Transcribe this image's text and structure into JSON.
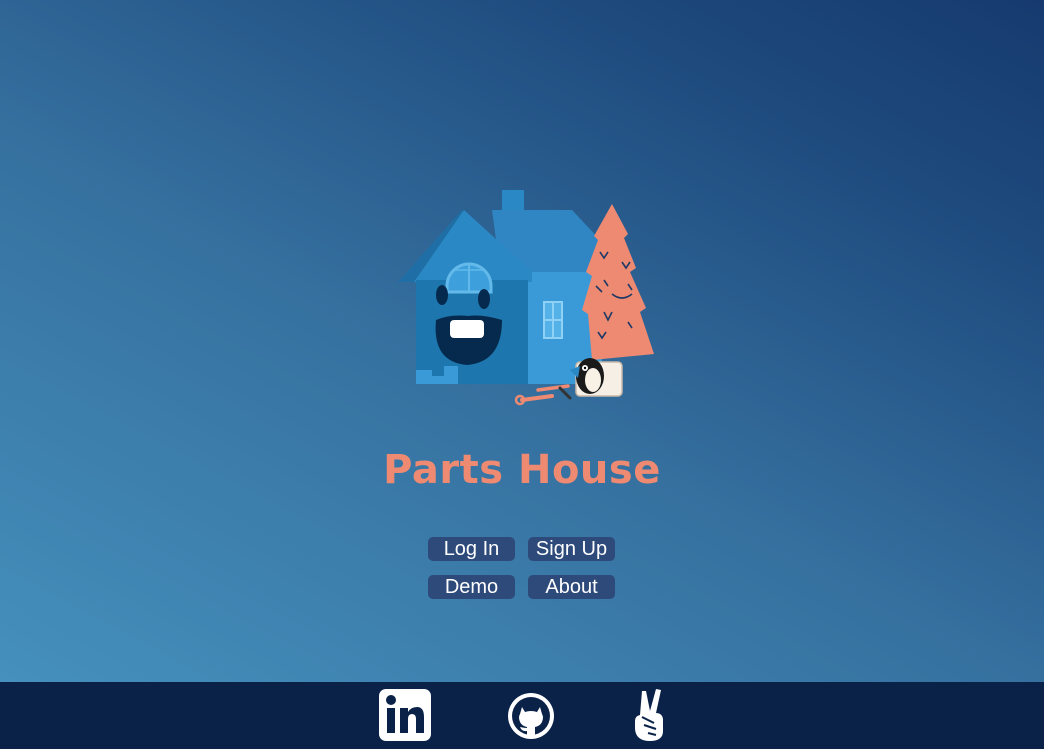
{
  "app": {
    "title": "Parts House"
  },
  "auth_buttons": {
    "login_label": "Log In",
    "signup_label": "Sign Up",
    "demo_label": "Demo",
    "about_label": "About"
  },
  "footer": {
    "links": [
      {
        "icon": "linkedin-icon"
      },
      {
        "icon": "github-icon"
      },
      {
        "icon": "angellist-icon"
      }
    ]
  },
  "colors": {
    "title": "#ee8a72",
    "button_bg": "#2d4a7a",
    "footer_bg": "#0b2248",
    "house": "#2a88c4",
    "tree": "#ee8a72"
  }
}
